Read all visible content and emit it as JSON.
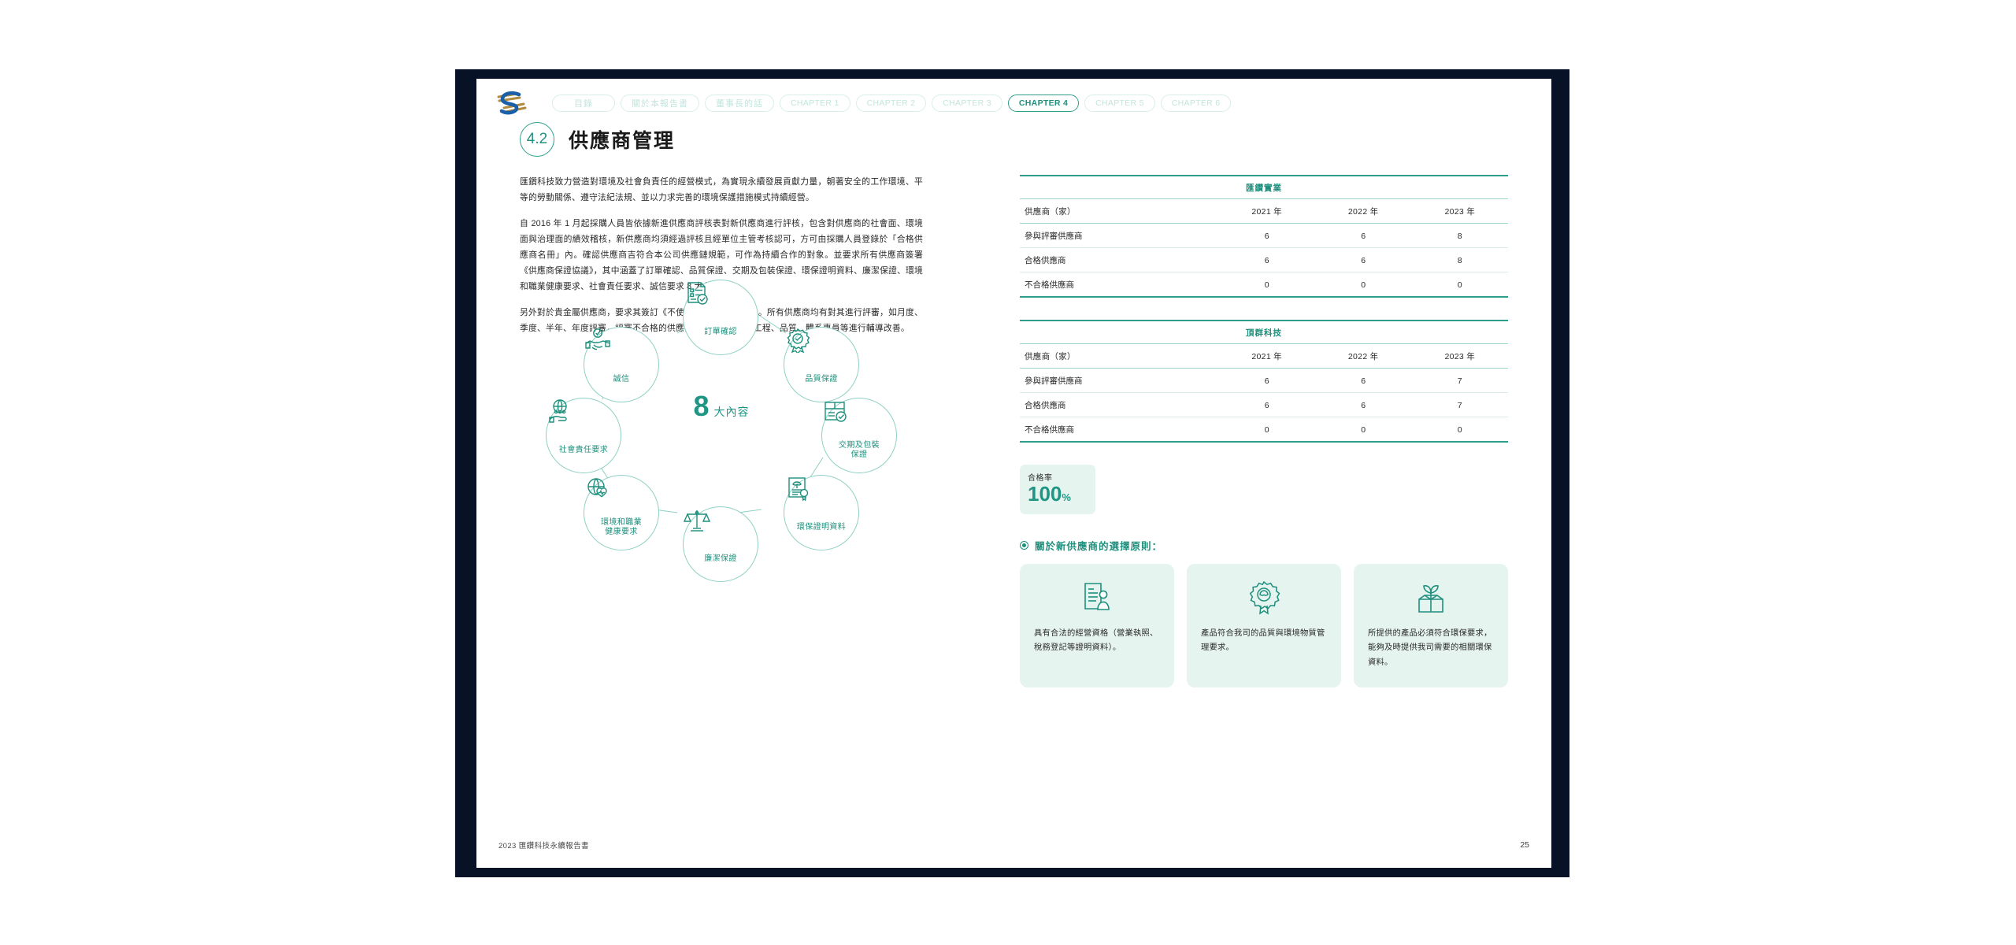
{
  "header": {
    "logo_alt": "company-logo",
    "tabs": [
      {
        "label": "目錄",
        "cjk": true,
        "active": false
      },
      {
        "label": "關於本報告書",
        "cjk": true,
        "active": false
      },
      {
        "label": "董事長的話",
        "cjk": true,
        "active": false
      },
      {
        "label": "CHAPTER 1",
        "cjk": false,
        "active": false
      },
      {
        "label": "CHAPTER 2",
        "cjk": false,
        "active": false
      },
      {
        "label": "CHAPTER 3",
        "cjk": false,
        "active": false
      },
      {
        "label": "CHAPTER 4",
        "cjk": false,
        "active": true
      },
      {
        "label": "CHAPTER 5",
        "cjk": false,
        "active": false
      },
      {
        "label": "CHAPTER 6",
        "cjk": false,
        "active": false
      }
    ]
  },
  "section": {
    "number": "4.2",
    "title": "供應商管理"
  },
  "body_paragraphs": [
    "匯鑽科技致力營造對環境及社會負責任的經營模式，為實現永續發展貢獻力量，朝著安全的工作環境、平等的勞動關係、遵守法紀法規、並以力求完善的環境保護措施模式持續經營。",
    "自 2016 年 1 月起採購人員皆依據新進供應商評核表對新供應商進行評核，包含對供應商的社會面、環境面與治理面的績效稽核，新供應商均須經過評核且經單位主管考核認可，方可由採購人員登錄於「合格供應商名冊」內。確認供應商吉符合本公司供應鏈規範，可作為持續合作的對象。並要求所有供應商簽署《供應商保證協議》，其中涵蓋了訂單確認、品質保證、交期及包裝保證、環保證明資料、廉潔保證、環境和職業健康要求、社會責任要求、誠信要求 8 大內容。",
    "另外對於貴金屬供應商，要求其簽訂《不使用衝突礦產承諾書》。所有供應商均有對其進行評審，如月度、季度、半年、年度評審，評審不合格的供應商，將會派採購、工程、品質、體系專員等進行輔導改善。"
  ],
  "diagram": {
    "center_number": "8",
    "center_unit": "大內容",
    "nodes": [
      {
        "label": "訂單確認",
        "icon": "document-check-icon"
      },
      {
        "label": "品質保證",
        "icon": "quality-badge-icon"
      },
      {
        "label": "交期及包裝\n保證",
        "icon": "package-check-icon"
      },
      {
        "label": "環保證明資料",
        "icon": "eco-certificate-icon"
      },
      {
        "label": "廉潔保證",
        "icon": "scales-icon"
      },
      {
        "label": "環境和職業\n健康要求",
        "icon": "globe-heart-icon"
      },
      {
        "label": "社會責任要求",
        "icon": "globe-hand-icon"
      },
      {
        "label": "誠信",
        "icon": "handshake-check-icon"
      }
    ]
  },
  "tables": [
    {
      "title": "匯鑽實業",
      "row_header": "供應商（家）",
      "columns": [
        "2021 年",
        "2022 年",
        "2023 年"
      ],
      "rows": [
        {
          "label": "參與評審供應商",
          "values": [
            "6",
            "6",
            "8"
          ]
        },
        {
          "label": "合格供應商",
          "values": [
            "6",
            "6",
            "8"
          ]
        },
        {
          "label": "不合格供應商",
          "values": [
            "0",
            "0",
            "0"
          ]
        }
      ]
    },
    {
      "title": "頂群科技",
      "row_header": "供應商（家）",
      "columns": [
        "2021 年",
        "2022 年",
        "2023 年"
      ],
      "rows": [
        {
          "label": "參與評審供應商",
          "values": [
            "6",
            "6",
            "7"
          ]
        },
        {
          "label": "合格供應商",
          "values": [
            "6",
            "6",
            "7"
          ]
        },
        {
          "label": "不合格供應商",
          "values": [
            "0",
            "0",
            "0"
          ]
        }
      ]
    }
  ],
  "rate_badge": {
    "label": "合格率",
    "value": "100",
    "unit": "%"
  },
  "principles": {
    "heading": "關於新供應商的選擇原則：",
    "cards": [
      {
        "icon": "document-person-icon",
        "text": "具有合法的經營資格（營業執照、稅務登記等證明資料）。"
      },
      {
        "icon": "quality-seal-icon",
        "text": "產品符合我司的品質與環境物質管理要求。"
      },
      {
        "icon": "eco-box-icon",
        "text": "所提供的產品必須符合環保要求，能夠及時提供我司需要的相關環保資料。"
      }
    ]
  },
  "footer": {
    "text": "2023 匯鑽科技永續報告書",
    "page": "25"
  },
  "colors": {
    "frame": "#081226",
    "teal": "#1d8f7c",
    "teal_light": "#8fd0c4",
    "card_bg": "#e6f4f0",
    "tab_inactive": "#c3e4dc"
  }
}
